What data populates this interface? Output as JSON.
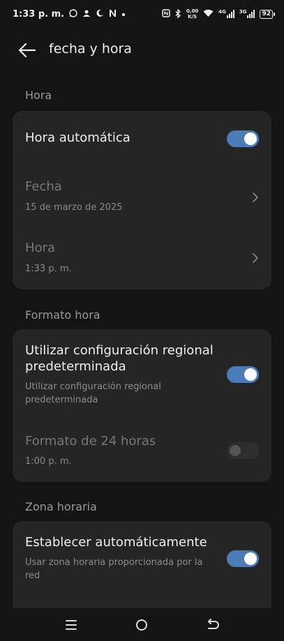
{
  "status": {
    "time": "1:33 p. m.",
    "net_speed_value": "0,00",
    "net_speed_unit": "K/S",
    "sim1": "4G",
    "sim2": "3G",
    "battery": "92"
  },
  "header": {
    "title": "fecha y hora"
  },
  "sections": {
    "hora": "Hora",
    "formato": "Formato hora",
    "zona": "Zona horaria"
  },
  "rows": {
    "auto_time": {
      "title": "Hora automática",
      "enabled": true
    },
    "date": {
      "title": "Fecha",
      "value": "15 de marzo de 2025"
    },
    "time": {
      "title": "Hora",
      "value": "1:33 p. m."
    },
    "regional": {
      "title": "Utilizar configuración regional predeterminada",
      "subtitle": "Utilizar configuración regional predeterminada",
      "enabled": true
    },
    "format24": {
      "title": "Formato de 24 horas",
      "value": "1:00 p. m.",
      "enabled": false
    },
    "auto_zone": {
      "title": "Establecer automáticamente",
      "subtitle": "Usar zona horaria proporcionada por la red",
      "enabled": true
    }
  },
  "colors": {
    "background": "#141414",
    "card": "#252525",
    "toggle_on": "#4a7db8",
    "toggle_off": "#2e2e2e"
  }
}
